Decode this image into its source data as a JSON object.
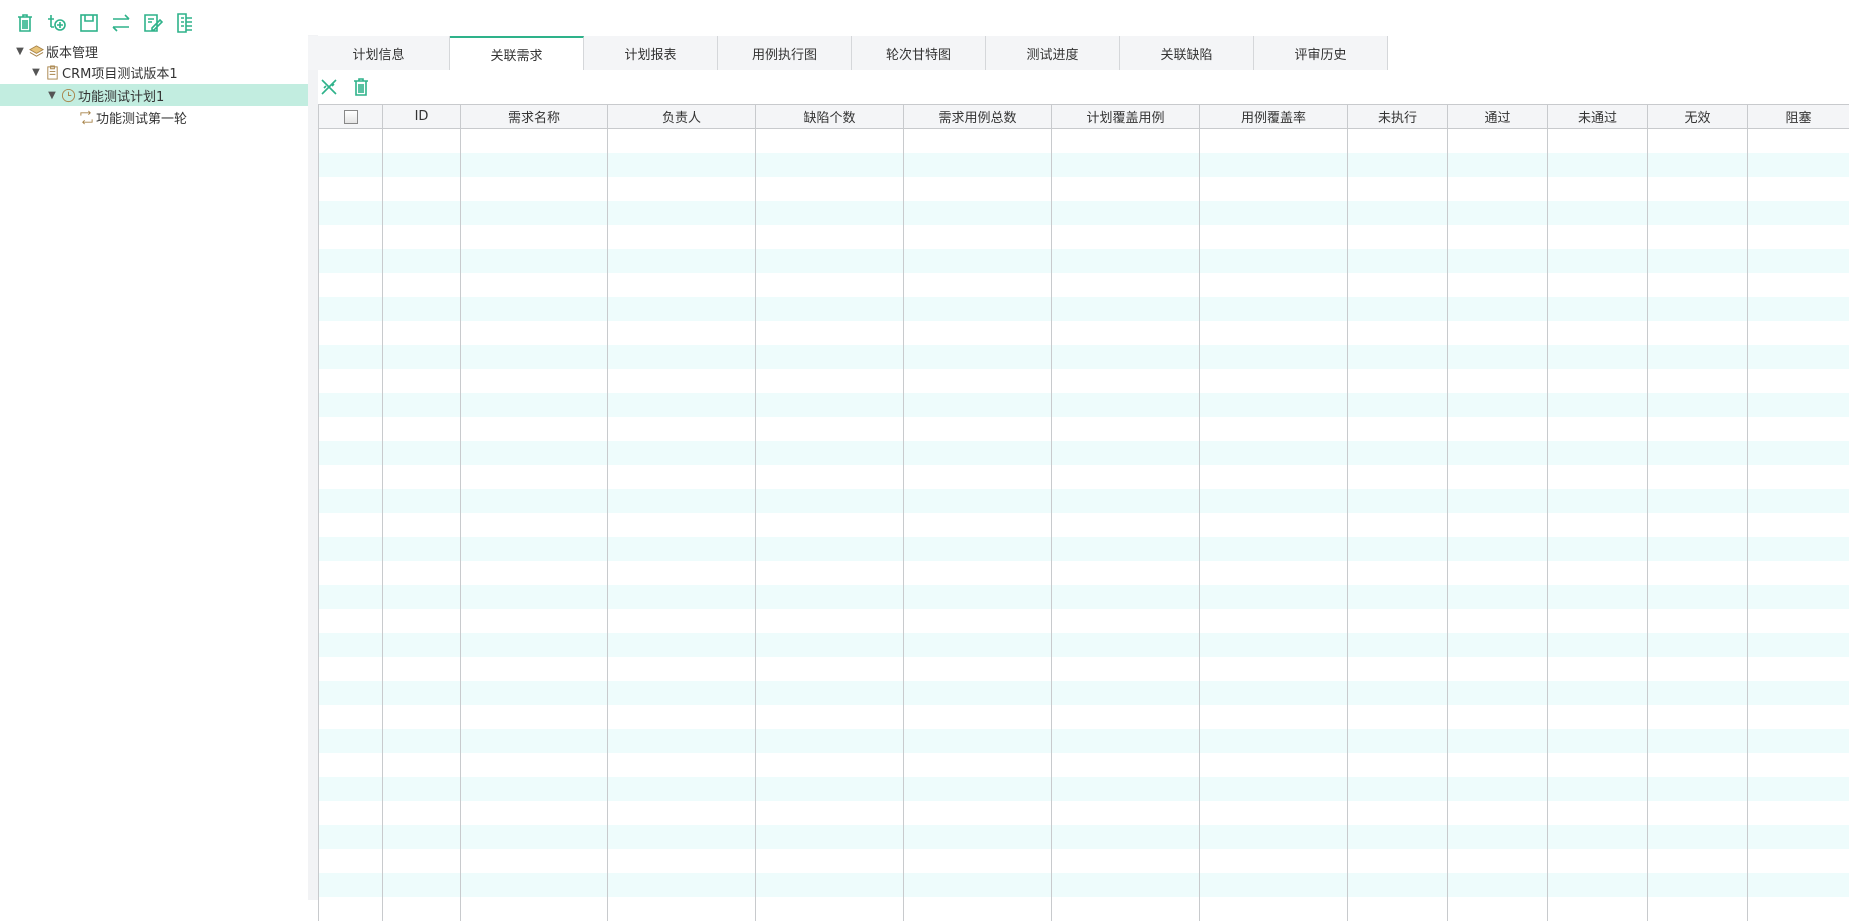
{
  "toolbar": {
    "icons": [
      "trash-icon",
      "add-plan-icon",
      "save-icon",
      "swap-icon",
      "edit-icon",
      "list-icon"
    ]
  },
  "tree": [
    {
      "label": "版本管理",
      "icon": "layers-icon",
      "level": 0,
      "expanded": true
    },
    {
      "label": "CRM项目测试版本1",
      "icon": "clipboard-icon",
      "level": 1,
      "expanded": true
    },
    {
      "label": "功能测试计划1",
      "icon": "clock-icon",
      "level": 2,
      "expanded": true,
      "selected": true
    },
    {
      "label": "功能测试第一轮",
      "icon": "cycle-icon",
      "level": 3
    }
  ],
  "tabs": [
    {
      "label": "计划信息"
    },
    {
      "label": "关联需求",
      "active": true
    },
    {
      "label": "计划报表"
    },
    {
      "label": "用例执行图"
    },
    {
      "label": "轮次甘特图"
    },
    {
      "label": "测试进度"
    },
    {
      "label": "关联缺陷"
    },
    {
      "label": "评审历史"
    }
  ],
  "subtoolbar": {
    "icons": [
      "unlink-icon",
      "trash-icon"
    ]
  },
  "table": {
    "columns": [
      "ID",
      "需求名称",
      "负责人",
      "缺陷个数",
      "需求用例总数",
      "计划覆盖用例",
      "用例覆盖率",
      "未执行",
      "通过",
      "未通过",
      "无效",
      "阻塞"
    ],
    "rows": []
  },
  "colors": {
    "accent": "#2eb28a",
    "selected": "#c2ede0",
    "stripe": "#eefcfc"
  }
}
